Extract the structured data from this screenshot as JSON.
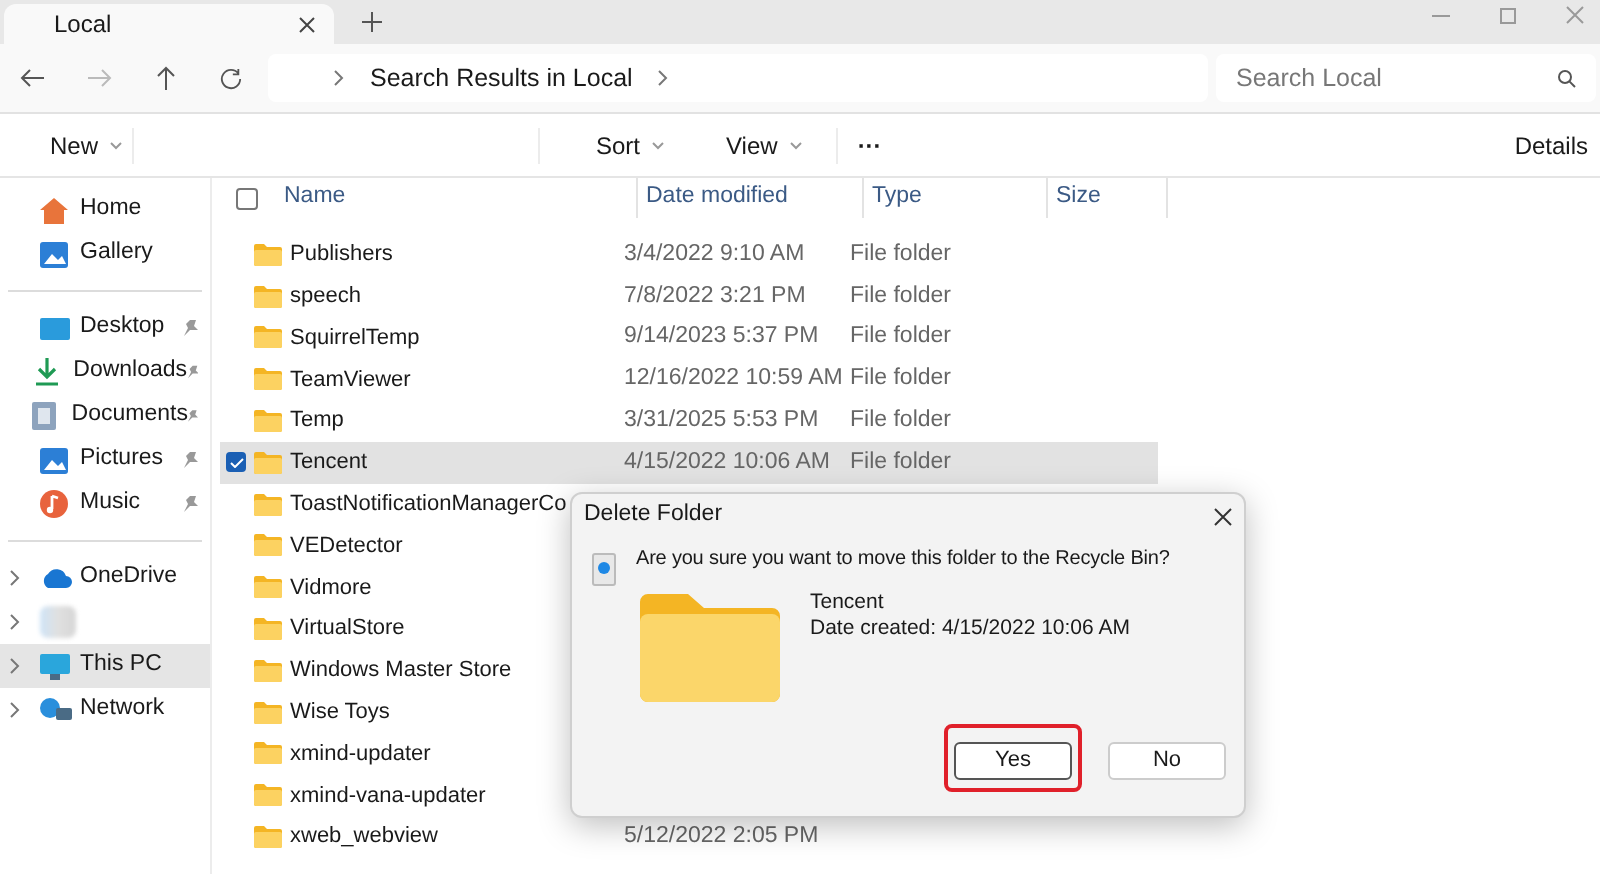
{
  "tabs": [
    {
      "label": "Local",
      "selected": true
    }
  ],
  "address": {
    "breadcrumb": "Search Results in Local"
  },
  "search": {
    "placeholder": "Search Local"
  },
  "toolbar": {
    "new": "New",
    "sort": "Sort",
    "view": "View",
    "more": "···",
    "details": "Details"
  },
  "sidebar": {
    "groups": [
      [
        {
          "label": "Home",
          "pinned": false,
          "expandable": false,
          "selected": false
        },
        {
          "label": "Gallery",
          "pinned": false,
          "expandable": false,
          "selected": false
        }
      ],
      [
        {
          "label": "Desktop",
          "pinned": true,
          "expandable": false,
          "selected": false
        },
        {
          "label": "Downloads",
          "pinned": true,
          "expandable": false,
          "selected": false
        },
        {
          "label": "Documents",
          "pinned": true,
          "expandable": false,
          "selected": false
        },
        {
          "label": "Pictures",
          "pinned": true,
          "expandable": false,
          "selected": false
        },
        {
          "label": "Music",
          "pinned": true,
          "expandable": false,
          "selected": false
        }
      ],
      [
        {
          "label": "OneDrive",
          "pinned": false,
          "expandable": true,
          "selected": false
        },
        {
          "pinned": false,
          "expandable": true,
          "selected": false
        },
        {
          "label": "This PC",
          "pinned": false,
          "expandable": true,
          "selected": true
        },
        {
          "label": "Network",
          "pinned": false,
          "expandable": true,
          "selected": false
        }
      ]
    ]
  },
  "table": {
    "select_all_checked": false,
    "columns": [
      "Name",
      "Date modified",
      "Type",
      "Size"
    ],
    "rows": [
      {
        "name": "Publishers",
        "date": "3/4/2022 9:10 AM",
        "type": "File folder",
        "selected": false
      },
      {
        "name": "speech",
        "date": "7/8/2022 3:21 PM",
        "type": "File folder",
        "selected": false
      },
      {
        "name": "SquirrelTemp",
        "date": "9/14/2023 5:37 PM",
        "type": "File folder",
        "selected": false
      },
      {
        "name": "TeamViewer",
        "date": "12/16/2022 10:59 AM",
        "type": "File folder",
        "selected": false
      },
      {
        "name": "Temp",
        "date": "3/31/2025 5:53 PM",
        "type": "File folder",
        "selected": false
      },
      {
        "name": "Tencent",
        "date": "4/15/2022 10:06 AM",
        "type": "File folder",
        "selected": true
      },
      {
        "name": "ToastNotificationManagerCo",
        "selected": false
      },
      {
        "name": "VEDetector",
        "selected": false
      },
      {
        "name": "Vidmore",
        "selected": false
      },
      {
        "name": "VirtualStore",
        "selected": false
      },
      {
        "name": "Windows Master Store",
        "selected": false
      },
      {
        "name": "Wise Toys",
        "selected": false
      },
      {
        "name": "xmind-updater",
        "selected": false
      },
      {
        "name": "xmind-vana-updater",
        "selected": false
      },
      {
        "name": "xweb_webview",
        "date": "5/12/2022 2:05 PM",
        "selected": false
      }
    ]
  },
  "dialog": {
    "title": "Delete Folder",
    "message": "Are you sure you want to move this folder to the Recycle Bin?",
    "item_name": "Tencent",
    "item_detail": "Date created: 4/15/2022 10:06 AM",
    "buttons": [
      {
        "label": "Yes",
        "highlighted": true
      },
      {
        "label": "No",
        "highlighted": false
      }
    ]
  }
}
